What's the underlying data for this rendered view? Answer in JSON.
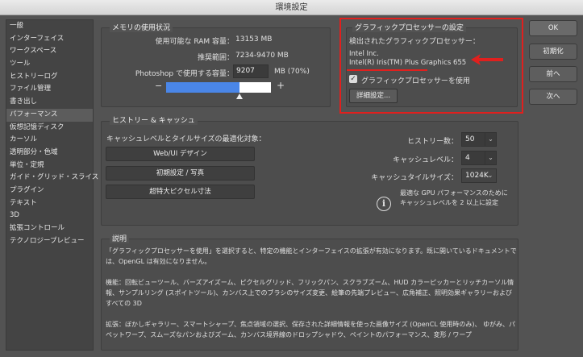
{
  "window": {
    "title": "環境設定"
  },
  "sidebar": {
    "items": [
      {
        "label": "一般"
      },
      {
        "label": "インターフェイス"
      },
      {
        "label": "ワークスペース"
      },
      {
        "label": "ツール"
      },
      {
        "label": "ヒストリーログ"
      },
      {
        "label": "ファイル管理"
      },
      {
        "label": "書き出し"
      },
      {
        "label": "パフォーマンス",
        "selected": true
      },
      {
        "label": "仮想記憶ディスク"
      },
      {
        "label": "カーソル"
      },
      {
        "label": "透明部分・色域"
      },
      {
        "label": "単位・定規"
      },
      {
        "label": "ガイド・グリッド・スライス"
      },
      {
        "label": "プラグイン"
      },
      {
        "label": "テキスト"
      },
      {
        "label": "3D"
      },
      {
        "label": "拡張コントロール"
      },
      {
        "label": "テクノロジープレビュー"
      }
    ]
  },
  "memory": {
    "title": "メモリの使用状況",
    "ram_label": "使用可能な RAM 容量：",
    "ram_value": "13153 MB",
    "range_label": "推奨範囲：",
    "range_value": "7234-9470 MB",
    "use_label": "Photoshop で使用する容量：",
    "use_value": "9207",
    "use_unit": "MB (70%)",
    "minus": "−",
    "plus": "+",
    "slider_percent": 70,
    "slider_color": "#4a86e8"
  },
  "gpu": {
    "title": "グラフィックプロセッサーの設定",
    "detected_label": "検出されたグラフィックプロセッサー：",
    "vendor": "Intel Inc.",
    "model": "Intel(R) Iris(TM) Plus Graphics 655",
    "use_gpu_label": "グラフィックプロセッサーを使用",
    "use_gpu_checked": true,
    "advanced_button": "詳細設定...",
    "highlight_color": "#e0201e"
  },
  "buttons": {
    "ok": "OK",
    "reset": "初期化",
    "prev": "前へ",
    "next": "次へ"
  },
  "history": {
    "title": "ヒストリー & キャッシュ",
    "optimize_label": "キャッシュレベルとタイルサイズの最適化対象：",
    "opt_buttons": [
      "Web/UI デザイン",
      "初期設定 / 写真",
      "超特大ピクセル寸法"
    ],
    "history_states_label": "ヒストリー数：",
    "history_states_value": "50",
    "cache_levels_label": "キャッシュレベル：",
    "cache_levels_value": "4",
    "tile_size_label": "キャッシュタイルサイズ：",
    "tile_size_value": "1024K",
    "info_text_1": "最適な GPU パフォーマンスのために",
    "info_text_2": "キャッシュレベルを 2 以上に設定"
  },
  "description": {
    "title": "説明",
    "p1": "「グラフィックプロセッサーを使用」を選択すると、特定の機能とインターフェイスの拡張が有効になります。既に開いているドキュメントでは、OpenGL は有効になりません。",
    "p2": "機能：回転ビューツール、バーズアイズーム、ピクセルグリッド、フリックパン、スクラブズーム、HUD カラーピッカーとリッチカーソル情報、サンプルリング (スポイトツール)、カンバス上でのブラシのサイズ変更、絵筆の先端プレビュー、広角補正、照明効果ギャラリーおよびすべての 3D",
    "p3": "拡張：ぼかしギャラリー、スマートシャープ、焦点領域の選択、保存された詳細情報を使った画像サイズ (OpenCL 使用時のみ)、 ゆがみ、パペットワープ、スムーズなパンおよびズーム、カンバス境界線のドロップシャドウ、ペイントのパフォーマンス、変形 / ワープ"
  }
}
